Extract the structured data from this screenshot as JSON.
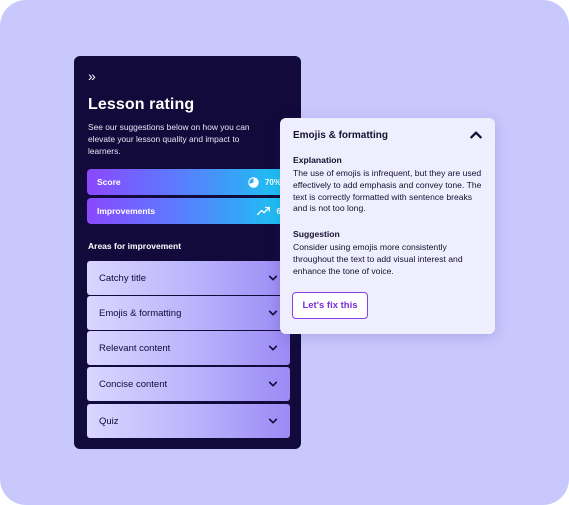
{
  "panel": {
    "expand_glyph": "»",
    "title": "Lesson rating",
    "subtitle": "See our suggestions below on how you can elevate your lesson quality and impact to learners.",
    "score": {
      "label": "Score",
      "value": "70%",
      "percent": 70,
      "icon": "pie-chart-icon"
    },
    "improvements": {
      "label": "Improvements",
      "value": "6",
      "icon": "trending-up-icon"
    },
    "areas_heading": "Areas for improvement",
    "areas": [
      {
        "label": "Catchy title"
      },
      {
        "label": "Emojis & formatting"
      },
      {
        "label": "Relevant content"
      },
      {
        "label": "Concise content"
      },
      {
        "label": "Quiz"
      }
    ]
  },
  "popup": {
    "title": "Emojis & formatting",
    "explanation_heading": "Explanation",
    "explanation_text": "The use of emojis is infrequent, but they are used effectively to add emphasis and convey tone. The text is correctly formatted with sentence breaks and is not too long.",
    "suggestion_heading": "Suggestion",
    "suggestion_text": "Consider using emojis more consistently throughout the text to add visual interest and enhance the tone of voice.",
    "fix_label": "Let's fix this"
  },
  "colors": {
    "background": "#c9c8fd",
    "panel": "#120a3a",
    "accent": "#8a3fe3",
    "gradient_start": "#8b48ff",
    "gradient_end": "#15c9f0"
  }
}
